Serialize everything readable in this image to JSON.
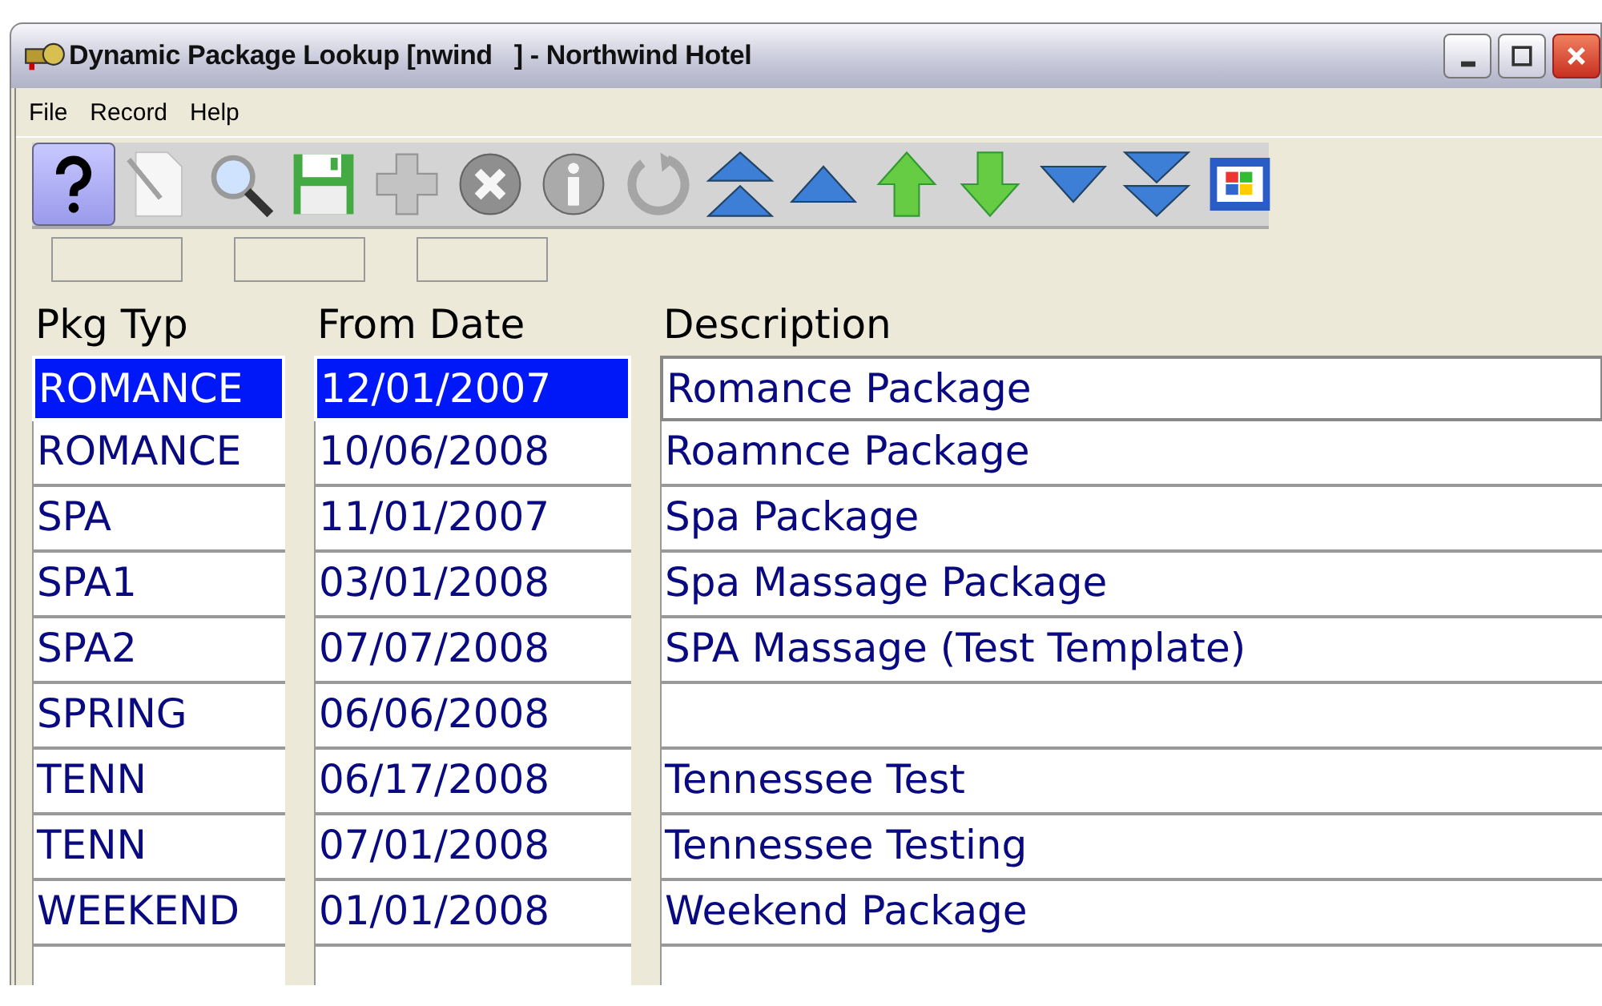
{
  "window": {
    "title": "Dynamic Package Lookup [nwind   ] - Northwind Hotel"
  },
  "menu": [
    "File",
    "Record",
    "Help"
  ],
  "toolbar": [
    {
      "kind": "help",
      "disabled": false
    },
    {
      "kind": "new",
      "disabled": true
    },
    {
      "kind": "find",
      "disabled": false
    },
    {
      "kind": "save",
      "disabled": false
    },
    {
      "kind": "add",
      "disabled": true
    },
    {
      "kind": "delete",
      "disabled": true
    },
    {
      "kind": "info",
      "disabled": true
    },
    {
      "kind": "undo",
      "disabled": true
    },
    {
      "kind": "first",
      "disabled": false
    },
    {
      "kind": "prev-page",
      "disabled": false
    },
    {
      "kind": "prev",
      "disabled": false
    },
    {
      "kind": "next",
      "disabled": false
    },
    {
      "kind": "next-page",
      "disabled": false
    },
    {
      "kind": "last",
      "disabled": false
    },
    {
      "kind": "windows",
      "disabled": false
    }
  ],
  "table": {
    "columns": [
      "Pkg Typ",
      "From Date",
      "Description"
    ],
    "rows": [
      {
        "type": "ROMANCE",
        "from": "12/01/2007",
        "description": "Romance Package",
        "selected": true
      },
      {
        "type": "ROMANCE",
        "from": "10/06/2008",
        "description": "Roamnce Package",
        "selected": false
      },
      {
        "type": "SPA",
        "from": "11/01/2007",
        "description": "Spa Package",
        "selected": false
      },
      {
        "type": "SPA1",
        "from": "03/01/2008",
        "description": "Spa Massage Package",
        "selected": false
      },
      {
        "type": "SPA2",
        "from": "07/07/2008",
        "description": "SPA Massage (Test Template)",
        "selected": false
      },
      {
        "type": "SPRING",
        "from": "06/06/2008",
        "selected": false
      },
      {
        "type": "TENN",
        "from": "06/17/2008",
        "description": "Tennessee Test",
        "selected": false
      },
      {
        "type": "TENN",
        "from": "07/01/2008",
        "description": "Tennessee Testing",
        "selected": false
      },
      {
        "type": "WEEKEND",
        "from": "01/01/2008",
        "description": "Weekend Package",
        "selected": false
      }
    ]
  }
}
